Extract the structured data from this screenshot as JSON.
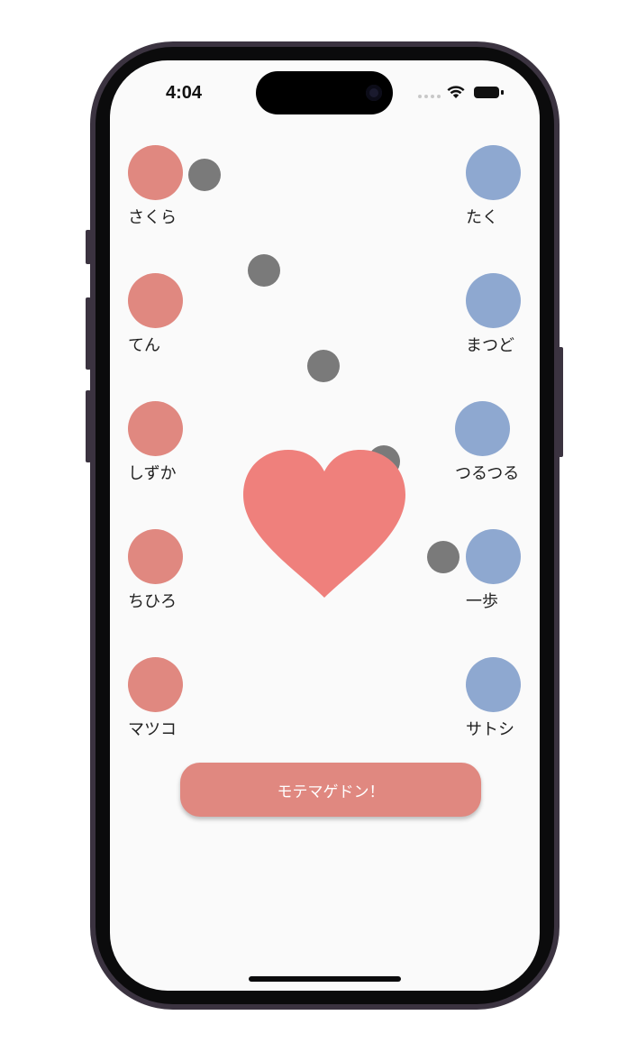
{
  "status_bar": {
    "time": "4:04"
  },
  "left_people": [
    {
      "name": "さくら"
    },
    {
      "name": "てん"
    },
    {
      "name": "しずか"
    },
    {
      "name": "ちひろ"
    },
    {
      "name": "マツコ"
    }
  ],
  "right_people": [
    {
      "name": "たく"
    },
    {
      "name": "まつど"
    },
    {
      "name": "つるつる"
    },
    {
      "name": "一歩"
    },
    {
      "name": "サトシ"
    }
  ],
  "action_button": {
    "label": "モテマゲドン！"
  },
  "colors": {
    "left_avatar": "#e08880",
    "right_avatar": "#8ea8d0",
    "heart": "#ef807c",
    "dot": "#7a7a7a",
    "button": "#e08880"
  }
}
